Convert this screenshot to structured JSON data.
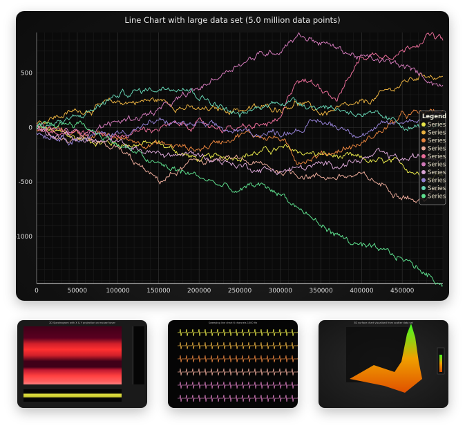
{
  "chart_data": {
    "type": "line",
    "title": "Line Chart with large data set (5.0 million data points)",
    "xlim": [
      0,
      500000
    ],
    "ylim": [
      -1430,
      870
    ],
    "x_ticks": [
      "0",
      "50000",
      "100000",
      "150000",
      "200000",
      "250000",
      "300000",
      "350000",
      "400000",
      "450000"
    ],
    "y_ticks": [
      "500",
      "0",
      "-500",
      "-1000"
    ],
    "grid": true,
    "legend_position": "right",
    "legend_title": "Legend",
    "background": "#0a0a0a",
    "series": [
      {
        "name": "Series",
        "color": "#e6e64a",
        "points": [
          [
            0,
            0
          ],
          [
            50000,
            -100
          ],
          [
            100000,
            -150
          ],
          [
            150000,
            -150
          ],
          [
            200000,
            -300
          ],
          [
            250000,
            -250
          ],
          [
            300000,
            -200
          ],
          [
            350000,
            -250
          ],
          [
            400000,
            -300
          ],
          [
            450000,
            -350
          ],
          [
            480000,
            -450
          ],
          [
            500000,
            -420
          ]
        ]
      },
      {
        "name": "Series",
        "color": "#e8b040",
        "points": [
          [
            0,
            50
          ],
          [
            50000,
            150
          ],
          [
            100000,
            230
          ],
          [
            150000,
            250
          ],
          [
            200000,
            150
          ],
          [
            250000,
            170
          ],
          [
            300000,
            180
          ],
          [
            320000,
            240
          ],
          [
            350000,
            130
          ],
          [
            400000,
            200
          ],
          [
            450000,
            400
          ],
          [
            480000,
            500
          ],
          [
            500000,
            450
          ]
        ]
      },
      {
        "name": "Series",
        "color": "#e8843e",
        "points": [
          [
            0,
            0
          ],
          [
            50000,
            -50
          ],
          [
            100000,
            -100
          ],
          [
            150000,
            -150
          ],
          [
            200000,
            -200
          ],
          [
            250000,
            -50
          ],
          [
            300000,
            -100
          ],
          [
            320000,
            -300
          ],
          [
            350000,
            -250
          ],
          [
            400000,
            -150
          ],
          [
            450000,
            100
          ],
          [
            500000,
            150
          ]
        ]
      },
      {
        "name": "Series",
        "color": "#e8a898",
        "points": [
          [
            0,
            0
          ],
          [
            50000,
            -150
          ],
          [
            100000,
            -200
          ],
          [
            150000,
            -500
          ],
          [
            200000,
            -300
          ],
          [
            250000,
            -300
          ],
          [
            300000,
            -400
          ],
          [
            350000,
            -450
          ],
          [
            400000,
            -450
          ],
          [
            450000,
            -600
          ],
          [
            470000,
            -680
          ],
          [
            500000,
            -550
          ]
        ]
      },
      {
        "name": "Series",
        "color": "#e86c98",
        "points": [
          [
            0,
            0
          ],
          [
            50000,
            -30
          ],
          [
            100000,
            -80
          ],
          [
            150000,
            0
          ],
          [
            200000,
            30
          ],
          [
            250000,
            -20
          ],
          [
            300000,
            50
          ],
          [
            320000,
            450
          ],
          [
            350000,
            380
          ],
          [
            370000,
            280
          ],
          [
            400000,
            650
          ],
          [
            450000,
            700
          ],
          [
            480000,
            850
          ],
          [
            500000,
            800
          ]
        ]
      },
      {
        "name": "Series",
        "color": "#d078b8",
        "points": [
          [
            0,
            0
          ],
          [
            50000,
            -50
          ],
          [
            100000,
            50
          ],
          [
            150000,
            150
          ],
          [
            200000,
            350
          ],
          [
            250000,
            600
          ],
          [
            300000,
            720
          ],
          [
            320000,
            860
          ],
          [
            350000,
            780
          ],
          [
            400000,
            640
          ],
          [
            450000,
            560
          ],
          [
            500000,
            380
          ]
        ]
      },
      {
        "name": "Series",
        "color": "#d8a4d4",
        "points": [
          [
            0,
            0
          ],
          [
            50000,
            -100
          ],
          [
            100000,
            -150
          ],
          [
            150000,
            -250
          ],
          [
            200000,
            -250
          ],
          [
            250000,
            -350
          ],
          [
            300000,
            -400
          ],
          [
            350000,
            -350
          ],
          [
            400000,
            -300
          ],
          [
            420000,
            -250
          ],
          [
            450000,
            -300
          ],
          [
            500000,
            -250
          ]
        ]
      },
      {
        "name": "Series",
        "color": "#9480d4",
        "points": [
          [
            0,
            -50
          ],
          [
            50000,
            -100
          ],
          [
            100000,
            -50
          ],
          [
            150000,
            50
          ],
          [
            200000,
            20
          ],
          [
            250000,
            -50
          ],
          [
            300000,
            -50
          ],
          [
            350000,
            50
          ],
          [
            400000,
            -50
          ],
          [
            450000,
            50
          ],
          [
            500000,
            150
          ]
        ]
      },
      {
        "name": "Series",
        "color": "#66d4b4",
        "points": [
          [
            0,
            0
          ],
          [
            50000,
            80
          ],
          [
            100000,
            300
          ],
          [
            150000,
            360
          ],
          [
            180000,
            400
          ],
          [
            200000,
            300
          ],
          [
            250000,
            100
          ],
          [
            300000,
            250
          ],
          [
            350000,
            200
          ],
          [
            400000,
            130
          ],
          [
            450000,
            20
          ],
          [
            480000,
            0
          ],
          [
            500000,
            0
          ]
        ]
      },
      {
        "name": "Series",
        "color": "#5ee08e",
        "points": [
          [
            0,
            0
          ],
          [
            50000,
            50
          ],
          [
            100000,
            -150
          ],
          [
            150000,
            -350
          ],
          [
            200000,
            -450
          ],
          [
            250000,
            -600
          ],
          [
            270000,
            -520
          ],
          [
            300000,
            -600
          ],
          [
            350000,
            -900
          ],
          [
            400000,
            -1100
          ],
          [
            450000,
            -1200
          ],
          [
            500000,
            -1430
          ]
        ]
      }
    ]
  },
  "thumbnails": [
    {
      "title": "2D Spectrogram with X & Y projection on mouse hover"
    },
    {
      "title": "Sweeping line chart 6 channels 1000 Hz"
    },
    {
      "title": "3D surface chart visualised from scatter data set"
    }
  ]
}
